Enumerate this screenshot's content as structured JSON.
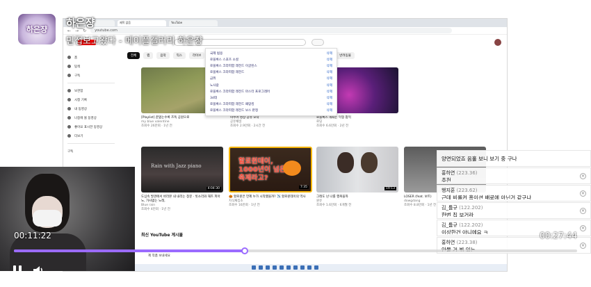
{
  "overlay": {
    "profile_text": "하은쟝",
    "channel_name": "하은쟝",
    "stream_title": "면접보고왔다 - 메이플갤러리 하은쟝"
  },
  "browser": {
    "tabs": [
      "YouTube",
      "제목 없음",
      "YouTube"
    ],
    "url": "youtube.com",
    "sidebar": [
      "홈",
      "탐색",
      "구독",
      "보관함",
      "시청 기록",
      "내 동영상",
      "나중에 볼 동영상",
      "좋아요 표시한 동영상",
      "더보기",
      "구독"
    ],
    "chips": [
      "전체",
      "랩",
      "음악",
      "믹스",
      "라이브",
      "게임",
      "뉴스",
      "Roblox",
      "액션 어드벤처 게임",
      "시각 예술",
      "요리",
      "반려동물"
    ],
    "dropdown": [
      {
        "text": "국제 범용",
        "action": "삭제"
      },
      {
        "text": "로블록스 스포츠 소셜",
        "action": "삭제"
      },
      {
        "text": "로블록스 크라피합 레전드 이글린스",
        "action": "삭제"
      },
      {
        "text": "로블록스 크라피합 레전드",
        "action": "삭제"
      },
      {
        "text": "금쥐",
        "action": "삭제"
      },
      {
        "text": "노사람",
        "action": "삭제"
      },
      {
        "text": "로블록스 크라피합 레전드 마스터 프로그래머",
        "action": "삭제"
      },
      {
        "text": "3d데",
        "action": "삭제"
      },
      {
        "text": "로블록스 크라피합 레전드 패망킹",
        "action": "삭제"
      },
      {
        "text": "로블록스 크라피합 레전드 보스 판정",
        "action": "삭제"
      }
    ],
    "videos_row1": [
      {
        "title": "[Playlist] 끝없는수록 즈독 공원으로",
        "channel": "my blue valentine",
        "stats": "조회수 26만회 · 1년 전"
      },
      {
        "title": "이주어 영상 공유 모작",
        "channel": "공유채널",
        "stats": "조회수 2.9만회 · 2시간 전"
      },
      {
        "title": "로블록스 개최는 먹형 펌먹",
        "channel": "로딩",
        "stats": "조회수 6.6만회 · 2년 전"
      }
    ],
    "videos_row2": [
      {
        "title": "도심속 발견에서 바라본 내 내리는 창문 · 빗소리와 재즈 피아노, 가사없는 노래,",
        "channel": "Blue rain",
        "stats": "조회수 4만회 · 1년 전",
        "duration": "4:04:30"
      },
      {
        "title": "🎃 할로윈은 언제 누가 시작했을까? ✈️ 할로윈데이의 역사",
        "channel": "지식채집소",
        "stats": "조회수 16만회 · 1년 전",
        "duration": "7:35"
      },
      {
        "title": "그래도 넌 나를 행복을까",
        "channel": "원유",
        "stats": "조회수 1.6만회 · 6개월 전",
        "duration": "19:13"
      },
      {
        "title": "LOSER (feat. 보트)",
        "channel": "dowgdang",
        "stats": "조회수 8.8만회 · 1년 전",
        "duration": ""
      }
    ],
    "thumb5_text_line1": "할로윈데이,",
    "thumb5_text_line2": "1000년이 넘은",
    "thumb5_text_line3": "축제라고?",
    "thumb4_text": "Rain with Jazz piano",
    "section_title": "최신 YouTube 게시물",
    "section_item": "제 작품 보내세요"
  },
  "chat": [
    {
      "user": "",
      "uid": "",
      "msg": "양면되었죠 음홀 보니 보기 중 구나"
    },
    {
      "user": "홍하연",
      "uid": "(223.36)",
      "msg": "추천"
    },
    {
      "user": "행지훈",
      "uid": "(223.62)",
      "msg": "근데 비롤커 홈이션 배로에 아닌거 같구나"
    },
    {
      "user": "김_튬규",
      "uid": "(122.202)",
      "msg": "한번 칩 보거라"
    },
    {
      "user": "김_튬규",
      "uid": "(122.202)",
      "msg": "이상한건 아니에요 ㅋ"
    },
    {
      "user": "홍하연",
      "uid": "(223.38)",
      "msg": "안물 거 뷔 있는"
    }
  ],
  "player": {
    "current_time": "00:11:22",
    "total_time": "00:27:44",
    "progress": 0.41,
    "accent_color": "#9b6bff"
  }
}
